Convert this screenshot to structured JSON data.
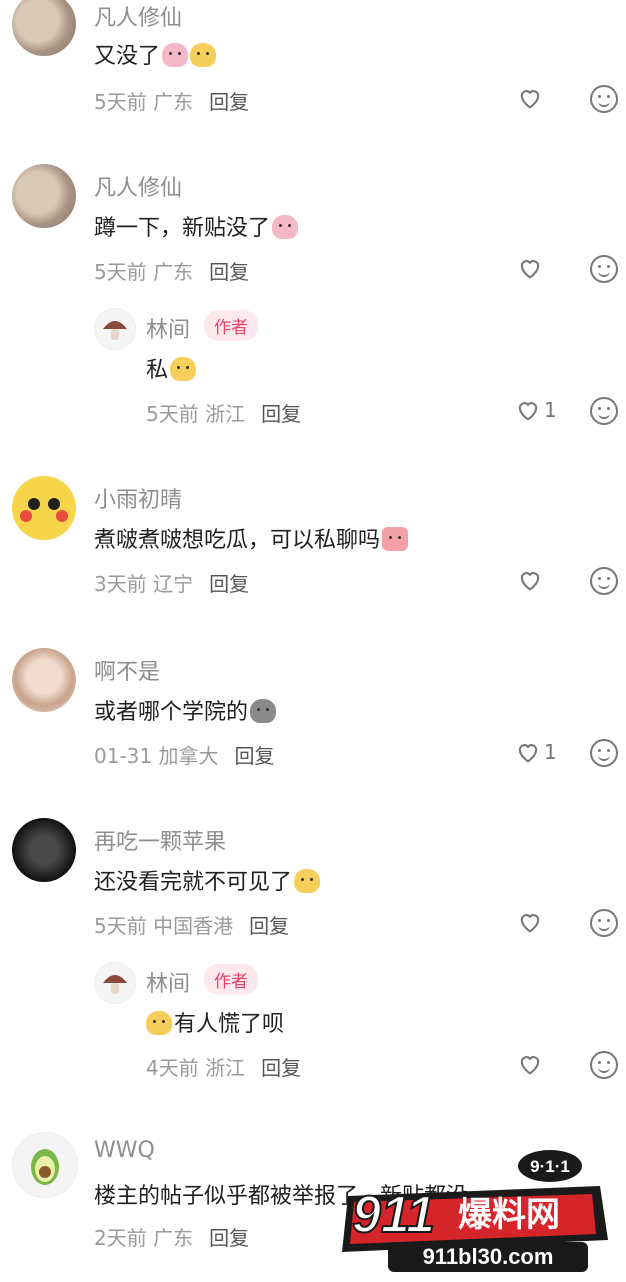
{
  "comments": [
    {
      "name": "凡人修仙",
      "text": "又没了",
      "emoji": [
        "pig",
        "duck"
      ],
      "time": "5天前",
      "location": "广东",
      "reply": "回复"
    },
    {
      "name": "凡人修仙",
      "text": "蹲一下，新贴没了",
      "emoji": [
        "pig"
      ],
      "time": "5天前",
      "location": "广东",
      "reply": "回复"
    },
    {
      "name": "林间",
      "tag": "作者",
      "text": "私",
      "emoji": [
        "duck"
      ],
      "time": "5天前",
      "location": "浙江",
      "reply": "回复",
      "likes": "1"
    },
    {
      "name": "小雨初晴",
      "text": "煮啵煮啵想吃瓜，可以私聊吗",
      "emoji": [
        "box"
      ],
      "time": "3天前",
      "location": "辽宁",
      "reply": "回复"
    },
    {
      "name": "啊不是",
      "text": "或者哪个学院的",
      "emoji": [
        "poop"
      ],
      "time": "01-31",
      "location": "加拿大",
      "reply": "回复",
      "likes": "1"
    },
    {
      "name": "再吃一颗苹果",
      "text": "还没看完就不可见了",
      "emoji": [
        "duck"
      ],
      "time": "5天前",
      "location": "中国香港",
      "reply": "回复"
    },
    {
      "name": "林间",
      "tag": "作者",
      "text": "有人慌了呗",
      "emoji_lead": "duck",
      "time": "4天前",
      "location": "浙江",
      "reply": "回复"
    },
    {
      "name": "WWQ",
      "text": "楼主的帖子似乎都被举报了，新贴都没",
      "time": "2天前",
      "location": "广东",
      "reply": "回复"
    }
  ],
  "watermark": {
    "brand_num": "911",
    "brand_cn": "爆料网",
    "badge": "9·1·1",
    "url": "911bl30.com"
  },
  "icons": {
    "like": "heart-outline-icon",
    "emoji": "smiley-icon"
  },
  "colors": {
    "author_tag": "#e8436b",
    "meta": "#9a9a9a",
    "watermark_red": "#d6242b"
  }
}
